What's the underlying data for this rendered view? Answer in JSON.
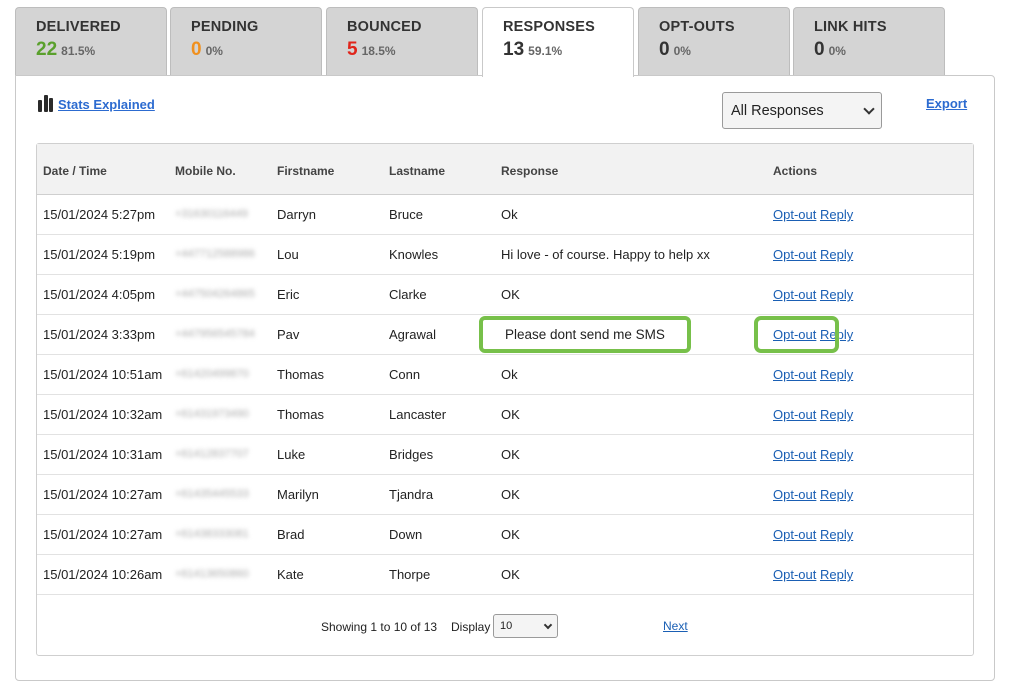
{
  "tabs": [
    {
      "label": "DELIVERED",
      "count": "22",
      "pct": "81.5%",
      "count_color": "#5aa02c"
    },
    {
      "label": "PENDING",
      "count": "0",
      "pct": "0%",
      "count_color": "#f0901e"
    },
    {
      "label": "BOUNCED",
      "count": "5",
      "pct": "18.5%",
      "count_color": "#e0251b"
    },
    {
      "label": "RESPONSES",
      "count": "13",
      "pct": "59.1%",
      "count_color": "#333333",
      "active": true
    },
    {
      "label": "OPT-OUTS",
      "count": "0",
      "pct": "0%",
      "count_color": "#333333"
    },
    {
      "label": "LINK HITS",
      "count": "0",
      "pct": "0%",
      "count_color": "#333333"
    }
  ],
  "toolbar": {
    "stats_link": "Stats Explained",
    "stats_icon": "bar-chart-icon",
    "filter_value": "All Responses",
    "export_label": "Export"
  },
  "table": {
    "headers": [
      "Date / Time",
      "Mobile No.",
      "Firstname",
      "Lastname",
      "Response",
      "Actions"
    ],
    "rows": [
      {
        "date": "15/01/2024 5:27pm",
        "mobile": "+31630116449",
        "first": "Darryn",
        "last": "Bruce",
        "response": "Ok"
      },
      {
        "date": "15/01/2024 5:19pm",
        "mobile": "+447712588986",
        "first": "Lou",
        "last": "Knowles",
        "response": "Hi love - of course. Happy to help xx"
      },
      {
        "date": "15/01/2024 4:05pm",
        "mobile": "+447504264865",
        "first": "Eric",
        "last": "Clarke",
        "response": "OK"
      },
      {
        "date": "15/01/2024 3:33pm",
        "mobile": "+447956545784",
        "first": "Pav",
        "last": "Agrawal",
        "response": "Please dont send me SMS",
        "highlighted": true
      },
      {
        "date": "15/01/2024 10:51am",
        "mobile": "+61420499870",
        "first": "Thomas",
        "last": "Conn",
        "response": "Ok"
      },
      {
        "date": "15/01/2024 10:32am",
        "mobile": "+61431973490",
        "first": "Thomas",
        "last": "Lancaster",
        "response": "OK"
      },
      {
        "date": "15/01/2024 10:31am",
        "mobile": "+61412837707",
        "first": "Luke",
        "last": "Bridges",
        "response": "OK"
      },
      {
        "date": "15/01/2024 10:27am",
        "mobile": "+61435445533",
        "first": "Marilyn",
        "last": "Tjandra",
        "response": "OK"
      },
      {
        "date": "15/01/2024 10:27am",
        "mobile": "+61438333081",
        "first": "Brad",
        "last": "Down",
        "response": "OK"
      },
      {
        "date": "15/01/2024 10:26am",
        "mobile": "+61413650860",
        "first": "Kate",
        "last": "Thorpe",
        "response": "OK"
      }
    ],
    "actions": {
      "optout": "Opt-out",
      "reply": "Reply"
    }
  },
  "footer": {
    "showing": "Showing 1 to 10 of 13",
    "display_label": "Display",
    "display_value": "10",
    "next_label": "Next"
  },
  "colors": {
    "highlight": "#77c04a",
    "link": "#1a5fb4"
  }
}
